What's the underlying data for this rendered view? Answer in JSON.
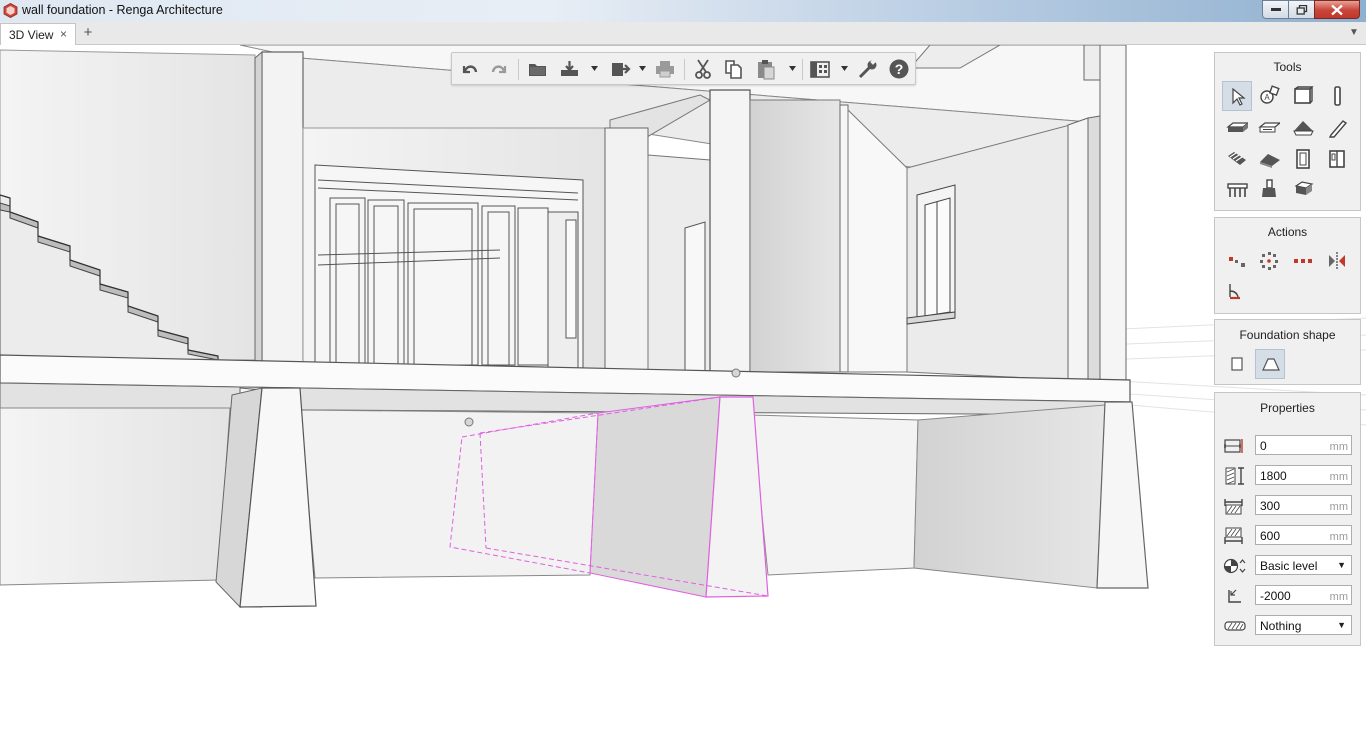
{
  "window": {
    "title": "wall foundation - Renga Architecture"
  },
  "tabs": [
    {
      "label": "3D View",
      "close": "×"
    }
  ],
  "tab_add": "+",
  "tab_menu": "▼",
  "toolbar": {
    "buttons": [
      "undo-icon",
      "redo-icon",
      "open-folder-icon",
      "save-icon",
      "export-icon",
      "print-icon",
      "cut-icon",
      "copy-icon",
      "paste-icon",
      "view-options-icon",
      "settings-wrench-icon",
      "help-icon"
    ]
  },
  "panels": {
    "tools": {
      "title": "Tools"
    },
    "actions": {
      "title": "Actions"
    },
    "foundation_shape": {
      "title": "Foundation shape",
      "options": [
        "rectangle-shape-icon",
        "trapezoid-shape-icon"
      ],
      "selected": "trapezoid-shape-icon"
    },
    "properties": {
      "title": "Properties",
      "rows": [
        {
          "icon": "offset-icon",
          "value": "0",
          "unit": "mm"
        },
        {
          "icon": "height-icon",
          "value": "1800",
          "unit": "mm"
        },
        {
          "icon": "top-width-icon",
          "value": "300",
          "unit": "mm"
        },
        {
          "icon": "bottom-width-icon",
          "value": "600",
          "unit": "mm"
        },
        {
          "icon": "level-icon",
          "value": "Basic level",
          "dropdown": true
        },
        {
          "icon": "elevation-icon",
          "value": "-2000",
          "unit": "mm"
        },
        {
          "icon": "style-icon",
          "value": "Nothing",
          "dropdown": true
        }
      ]
    }
  },
  "colors": {
    "selection": "#e060e0",
    "panel_bg": "#f0f0f0",
    "viewport_bg": "#ffffff"
  }
}
